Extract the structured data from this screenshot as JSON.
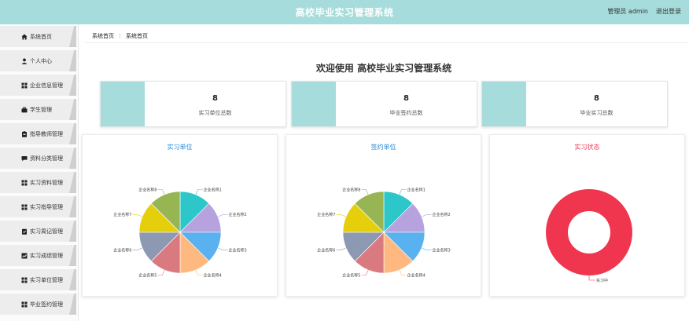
{
  "header": {
    "title": "高校毕业实习管理系统",
    "user": "管理员 admin",
    "logout": "退出登录"
  },
  "sidebar": {
    "items": [
      {
        "label": "系统首页",
        "icon": "home-icon"
      },
      {
        "label": "个人中心",
        "icon": "user-icon"
      },
      {
        "label": "企业信息管理",
        "icon": "grid-icon"
      },
      {
        "label": "学生管理",
        "icon": "briefcase-icon"
      },
      {
        "label": "指导教师管理",
        "icon": "clipboard-icon"
      },
      {
        "label": "资料分类管理",
        "icon": "message-icon"
      },
      {
        "label": "实习资料管理",
        "icon": "grid-icon"
      },
      {
        "label": "实习指导管理",
        "icon": "grid-icon"
      },
      {
        "label": "实习周记管理",
        "icon": "checklist-icon"
      },
      {
        "label": "实习成绩管理",
        "icon": "chart-icon"
      },
      {
        "label": "实习单位管理",
        "icon": "grid-icon"
      },
      {
        "label": "毕业签约管理",
        "icon": "grid-icon"
      }
    ]
  },
  "breadcrumb": {
    "root": "系统首页",
    "separator": "⋮",
    "current": "系统首页"
  },
  "welcome": "欢迎使用 高校毕业实习管理系统",
  "stats": [
    {
      "value": "8",
      "label": "实习单位总数"
    },
    {
      "value": "8",
      "label": "毕业签约总数"
    },
    {
      "value": "8",
      "label": "毕业实习总数"
    }
  ],
  "colors": {
    "accent": "#a6dcdb",
    "pie": [
      "#2ec7c9",
      "#b6a2de",
      "#5ab1ef",
      "#ffb980",
      "#d87a80",
      "#8d98b3",
      "#e5cf0d",
      "#97b552"
    ],
    "donut": "#f0364f",
    "title_blue": "#2589d6",
    "title_red": "#f0364f"
  },
  "chart_data": [
    {
      "type": "pie",
      "title": "实习单位",
      "categories": [
        "企业名称1",
        "企业名称2",
        "企业名称3",
        "企业名称4",
        "企业名称5",
        "企业名称6",
        "企业名称7",
        "企业名称8"
      ],
      "values": [
        1,
        1,
        1,
        1,
        1,
        1,
        1,
        1
      ]
    },
    {
      "type": "pie",
      "title": "签约单位",
      "categories": [
        "企业名称1",
        "企业名称2",
        "企业名称3",
        "企业名称4",
        "企业名称5",
        "企业名称6",
        "企业名称7",
        "企业名称8"
      ],
      "values": [
        1,
        1,
        1,
        1,
        1,
        1,
        1,
        1
      ]
    },
    {
      "type": "pie",
      "title": "实习状态",
      "categories": [
        "实习中"
      ],
      "values": [
        8
      ]
    }
  ]
}
